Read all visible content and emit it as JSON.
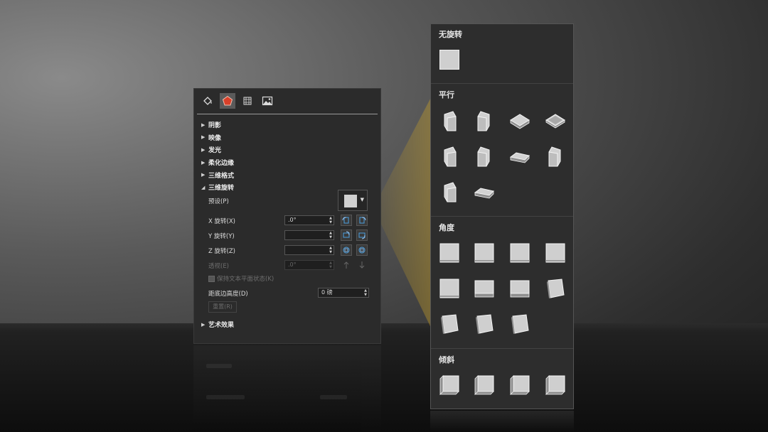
{
  "panel": {
    "tabs": [
      {
        "name": "fill-line-tab"
      },
      {
        "name": "effects-tab",
        "active": true
      },
      {
        "name": "size-properties-tab"
      },
      {
        "name": "picture-tab"
      }
    ],
    "sections": [
      {
        "label": "阴影",
        "expanded": false
      },
      {
        "label": "映像",
        "expanded": false
      },
      {
        "label": "发光",
        "expanded": false
      },
      {
        "label": "柔化边缘",
        "expanded": false
      },
      {
        "label": "三维格式",
        "expanded": false
      },
      {
        "label": "三维旋转",
        "expanded": true
      }
    ],
    "rotation": {
      "preset_label": "预设(P)",
      "x_label": "X 旋转(X)",
      "x_value": ".0°",
      "y_label": "Y 旋转(Y)",
      "y_value": "",
      "z_label": "Z 旋转(Z)",
      "z_value": "",
      "perspective_label": "透视(E)",
      "perspective_value": ".0°",
      "keep_text_flat_label": "保持文本平面状态(K)",
      "distance_label": "距底边高度(D)",
      "distance_value": "0 磅",
      "reset_label": "重置(R)"
    },
    "art_effects_label": "艺术效果"
  },
  "gallery": {
    "sections": [
      {
        "title": "无旋转",
        "items": 1
      },
      {
        "title": "平行",
        "items": 10
      },
      {
        "title": "角度",
        "items": 11
      },
      {
        "title": "倾斜",
        "items": 4
      }
    ]
  },
  "colors": {
    "panel_bg": "#2b2b2b",
    "gallery_bg": "#2d2d2d",
    "active_tab_icon": "#d9402a",
    "beam": "#c8a028"
  }
}
